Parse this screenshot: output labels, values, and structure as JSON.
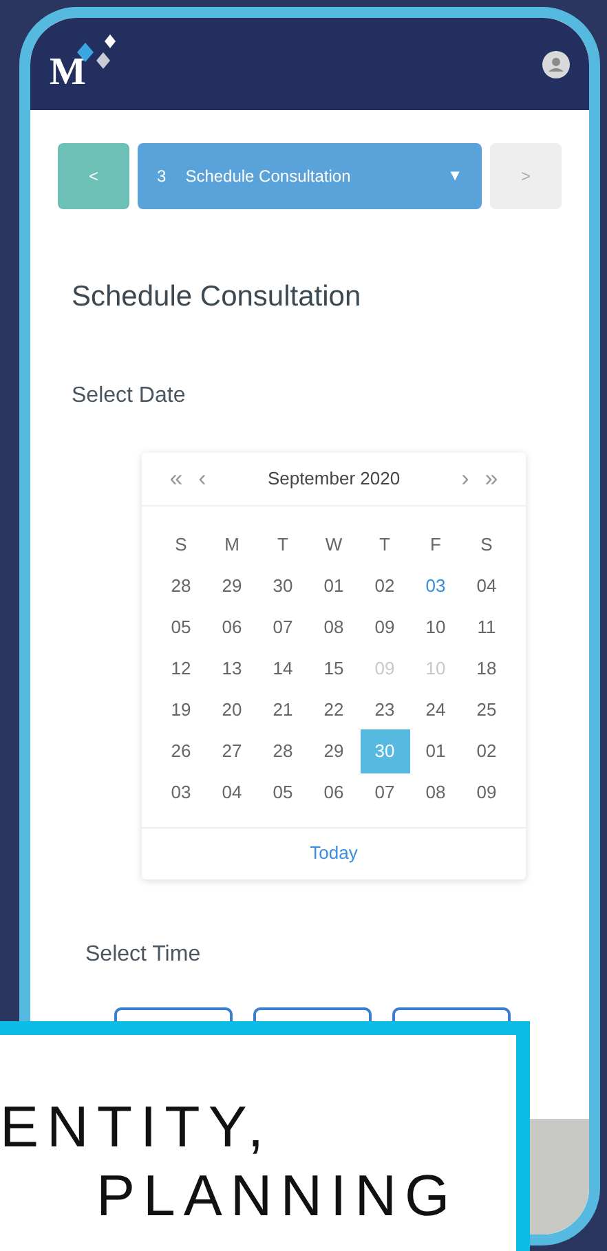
{
  "header": {
    "logo": "M"
  },
  "stepper": {
    "back": "<",
    "step_number": "3",
    "step_title": "Schedule Consultation",
    "caret": "▼",
    "next": ">",
    "next_disabled": true
  },
  "title": "Schedule Consultation",
  "date_section": {
    "label": "Select Date"
  },
  "calendar": {
    "prev_year": "«",
    "prev_month": "‹",
    "month": "September 2020",
    "next_month": "›",
    "next_year": "»",
    "weekdays": [
      "S",
      "M",
      "T",
      "W",
      "T",
      "F",
      "S"
    ],
    "days": [
      {
        "text": "28",
        "selected": false,
        "disabled": false,
        "today": false
      },
      {
        "text": "29",
        "selected": false,
        "disabled": false,
        "today": false
      },
      {
        "text": "30",
        "selected": false,
        "disabled": false,
        "today": false
      },
      {
        "text": "01",
        "selected": false,
        "disabled": false,
        "today": false
      },
      {
        "text": "02",
        "selected": false,
        "disabled": false,
        "today": false
      },
      {
        "text": "03",
        "selected": false,
        "disabled": false,
        "today": true
      },
      {
        "text": "04",
        "selected": false,
        "disabled": false,
        "today": false
      },
      {
        "text": "05",
        "selected": false,
        "disabled": false,
        "today": false
      },
      {
        "text": "06",
        "selected": false,
        "disabled": false,
        "today": false
      },
      {
        "text": "07",
        "selected": false,
        "disabled": false,
        "today": false
      },
      {
        "text": "08",
        "selected": false,
        "disabled": false,
        "today": false
      },
      {
        "text": "09",
        "selected": false,
        "disabled": false,
        "today": false
      },
      {
        "text": "10",
        "selected": false,
        "disabled": false,
        "today": false
      },
      {
        "text": "11",
        "selected": false,
        "disabled": false,
        "today": false
      },
      {
        "text": "12",
        "selected": false,
        "disabled": false,
        "today": false
      },
      {
        "text": "13",
        "selected": false,
        "disabled": false,
        "today": false
      },
      {
        "text": "14",
        "selected": false,
        "disabled": false,
        "today": false
      },
      {
        "text": "15",
        "selected": false,
        "disabled": false,
        "today": false
      },
      {
        "text": "09",
        "selected": false,
        "disabled": true,
        "today": false
      },
      {
        "text": "10",
        "selected": false,
        "disabled": true,
        "today": false
      },
      {
        "text": "18",
        "selected": false,
        "disabled": false,
        "today": false
      },
      {
        "text": "19",
        "selected": false,
        "disabled": false,
        "today": false
      },
      {
        "text": "20",
        "selected": false,
        "disabled": false,
        "today": false
      },
      {
        "text": "21",
        "selected": false,
        "disabled": false,
        "today": false
      },
      {
        "text": "22",
        "selected": false,
        "disabled": false,
        "today": false
      },
      {
        "text": "23",
        "selected": false,
        "disabled": false,
        "today": false
      },
      {
        "text": "24",
        "selected": false,
        "disabled": false,
        "today": false
      },
      {
        "text": "25",
        "selected": false,
        "disabled": false,
        "today": false
      },
      {
        "text": "26",
        "selected": false,
        "disabled": false,
        "today": false
      },
      {
        "text": "27",
        "selected": false,
        "disabled": false,
        "today": false
      },
      {
        "text": "28",
        "selected": false,
        "disabled": false,
        "today": false
      },
      {
        "text": "29",
        "selected": false,
        "disabled": false,
        "today": false
      },
      {
        "text": "30",
        "selected": true,
        "disabled": false,
        "today": false
      },
      {
        "text": "01",
        "selected": false,
        "disabled": false,
        "today": false
      },
      {
        "text": "02",
        "selected": false,
        "disabled": false,
        "today": false
      },
      {
        "text": "03",
        "selected": false,
        "disabled": false,
        "today": false
      },
      {
        "text": "04",
        "selected": false,
        "disabled": false,
        "today": false
      },
      {
        "text": "05",
        "selected": false,
        "disabled": false,
        "today": false
      },
      {
        "text": "06",
        "selected": false,
        "disabled": false,
        "today": false
      },
      {
        "text": "07",
        "selected": false,
        "disabled": false,
        "today": false
      },
      {
        "text": "08",
        "selected": false,
        "disabled": false,
        "today": false
      },
      {
        "text": "09",
        "selected": false,
        "disabled": false,
        "today": false
      }
    ],
    "today_link": "Today"
  },
  "time_section": {
    "label": "Select Time"
  },
  "overlay_banner": {
    "lines": [
      "ENTITY,",
      "PLANNING"
    ]
  }
}
